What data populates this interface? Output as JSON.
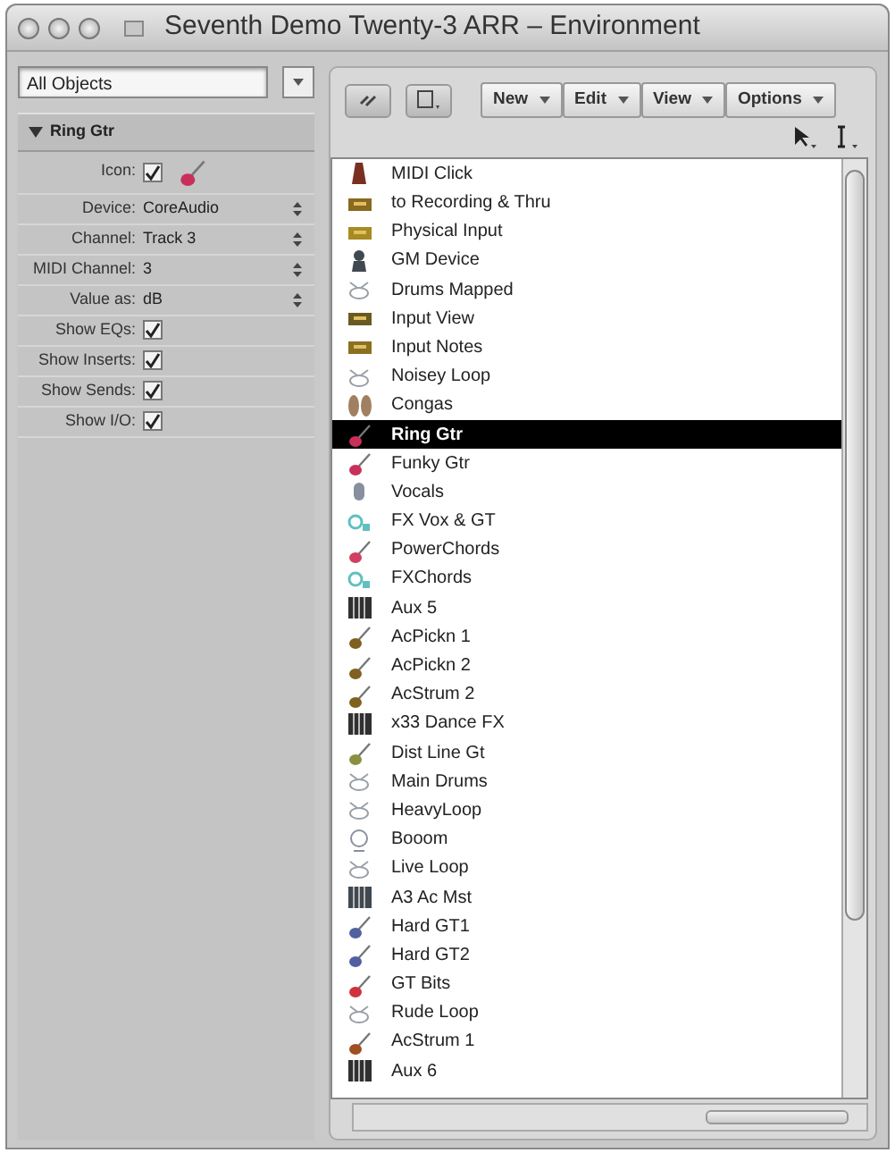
{
  "window": {
    "title": "Seventh Demo Twenty-3 ARR – Environment"
  },
  "layer_menu": {
    "value": "All Objects"
  },
  "inspector": {
    "title": "Ring Gtr",
    "expanded": true,
    "rows": [
      {
        "kind": "icon",
        "label": "Icon:",
        "checked": true,
        "color": "#c8305a"
      },
      {
        "kind": "select",
        "label": "Device:",
        "value": "CoreAudio"
      },
      {
        "kind": "select",
        "label": "Channel:",
        "value": "Track 3"
      },
      {
        "kind": "select",
        "label": "MIDI Channel:",
        "value": "3"
      },
      {
        "kind": "select",
        "label": "Value as:",
        "value": "dB"
      },
      {
        "kind": "check",
        "label": "Show EQs:",
        "checked": true
      },
      {
        "kind": "check",
        "label": "Show Inserts:",
        "checked": true
      },
      {
        "kind": "check",
        "label": "Show Sends:",
        "checked": true
      },
      {
        "kind": "check",
        "label": "Show I/O:",
        "checked": true
      }
    ]
  },
  "menus": [
    "New",
    "Edit",
    "View",
    "Options"
  ],
  "objects": [
    {
      "name": "MIDI Click",
      "kind": "metronome",
      "color": "#7a3020",
      "selected": false
    },
    {
      "name": "to Recording & Thru",
      "kind": "module",
      "color": "#8a6a20",
      "selected": false
    },
    {
      "name": "Physical Input",
      "kind": "module",
      "color": "#a88a20",
      "selected": false
    },
    {
      "name": "GM Device",
      "kind": "device",
      "color": "#404850",
      "selected": false
    },
    {
      "name": "Drums Mapped",
      "kind": "drums",
      "color": "#9aa0a8",
      "selected": false
    },
    {
      "name": "Input View",
      "kind": "module",
      "color": "#6a5a20",
      "selected": false
    },
    {
      "name": "Input Notes",
      "kind": "module",
      "color": "#8a7020",
      "selected": false
    },
    {
      "name": "Noisey Loop",
      "kind": "drums",
      "color": "#9aa0a8",
      "selected": false
    },
    {
      "name": "Congas",
      "kind": "conga",
      "color": "#a08060",
      "selected": false
    },
    {
      "name": "Ring Gtr",
      "kind": "guitar",
      "color": "#c8305a",
      "selected": true
    },
    {
      "name": "Funky Gtr",
      "kind": "guitar",
      "color": "#c8305a",
      "selected": false
    },
    {
      "name": "Vocals",
      "kind": "mic",
      "color": "#8890a0",
      "selected": false
    },
    {
      "name": "FX Vox & GT",
      "kind": "fx",
      "color": "#60c0c0",
      "selected": false
    },
    {
      "name": "PowerChords",
      "kind": "guitar",
      "color": "#d04060",
      "selected": false
    },
    {
      "name": "FXChords",
      "kind": "fx",
      "color": "#60c0c0",
      "selected": false
    },
    {
      "name": "Aux 5",
      "kind": "aux",
      "color": "#303030",
      "selected": false
    },
    {
      "name": "AcPickn 1",
      "kind": "guitar",
      "color": "#806020",
      "selected": false
    },
    {
      "name": "AcPickn 2",
      "kind": "guitar",
      "color": "#806020",
      "selected": false
    },
    {
      "name": "AcStrum 2",
      "kind": "guitar",
      "color": "#806020",
      "selected": false
    },
    {
      "name": "x33 Dance FX",
      "kind": "aux",
      "color": "#303030",
      "selected": false
    },
    {
      "name": "Dist Line Gt",
      "kind": "guitar",
      "color": "#8a9040",
      "selected": false
    },
    {
      "name": "Main Drums",
      "kind": "drums",
      "color": "#9aa0a8",
      "selected": false
    },
    {
      "name": "HeavyLoop",
      "kind": "drums",
      "color": "#9aa0a8",
      "selected": false
    },
    {
      "name": "Booom",
      "kind": "gong",
      "color": "#8890a0",
      "selected": false
    },
    {
      "name": "Live Loop",
      "kind": "drums",
      "color": "#9aa0a8",
      "selected": false
    },
    {
      "name": "A3 Ac Mst",
      "kind": "aux",
      "color": "#404850",
      "selected": false
    },
    {
      "name": "Hard GT1",
      "kind": "guitar",
      "color": "#5060a0",
      "selected": false
    },
    {
      "name": "Hard GT2",
      "kind": "guitar",
      "color": "#5060a0",
      "selected": false
    },
    {
      "name": "GT Bits",
      "kind": "guitar",
      "color": "#d03040",
      "selected": false
    },
    {
      "name": "Rude Loop",
      "kind": "drums",
      "color": "#9aa0a8",
      "selected": false
    },
    {
      "name": "AcStrum 1",
      "kind": "guitar",
      "color": "#a05020",
      "selected": false
    },
    {
      "name": "Aux 6",
      "kind": "aux",
      "color": "#303030",
      "selected": false
    }
  ]
}
